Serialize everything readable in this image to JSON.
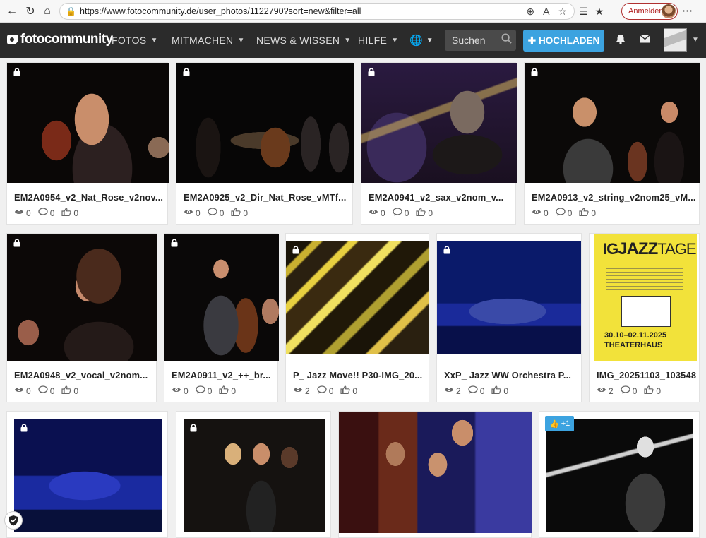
{
  "browser": {
    "url": "https://www.fotocommunity.de/user_photos/1122790?sort=new&filter=all",
    "login_label": "Anmelden"
  },
  "header": {
    "logo": "fotocommunity",
    "nav": [
      {
        "label": "FOTOS"
      },
      {
        "label": "MITMACHEN"
      },
      {
        "label": "NEWS & WISSEN"
      },
      {
        "label": "HILFE"
      }
    ],
    "search_placeholder": "Suchen",
    "upload_label": "HOCHLADEN"
  },
  "colors": {
    "header_bg": "#2b2b2b",
    "accent": "#3ca3e0"
  },
  "photos": [
    {
      "title": "EM2A0954_v2_Nat_Rose_v2nov...",
      "views": "0",
      "comments": "0",
      "likes": "0",
      "locked": true
    },
    {
      "title": "EM2A0925_v2_Dir_Nat_Rose_vMTf...",
      "views": "0",
      "comments": "0",
      "likes": "0",
      "locked": true
    },
    {
      "title": "EM2A0941_v2_sax_v2nom_v...",
      "views": "0",
      "comments": "0",
      "likes": "0",
      "locked": true
    },
    {
      "title": "EM2A0913_v2_string_v2nom25_vM...",
      "views": "0",
      "comments": "0",
      "likes": "0",
      "locked": true
    },
    {
      "title": "EM2A0948_v2_vocal_v2nom...",
      "views": "0",
      "comments": "0",
      "likes": "0",
      "locked": true
    },
    {
      "title": "EM2A0911_v2_++_br...",
      "views": "0",
      "comments": "0",
      "likes": "0",
      "locked": true
    },
    {
      "title": "P_ Jazz Move!! P30-IMG_20...",
      "views": "2",
      "comments": "0",
      "likes": "0",
      "locked": true
    },
    {
      "title": "XxP_ Jazz WW Orchestra P...",
      "views": "2",
      "comments": "0",
      "likes": "0",
      "locked": true
    },
    {
      "title": "IMG_20251103_103548",
      "views": "2",
      "comments": "0",
      "likes": "0",
      "locked": false
    },
    {
      "title": "",
      "locked": true
    },
    {
      "title": "",
      "locked": true
    },
    {
      "title": "",
      "locked": false
    },
    {
      "title": "",
      "locked": false,
      "like_badge": "+1"
    }
  ],
  "poster": {
    "line1": "IG",
    "line2": "JAZZ",
    "line3": "TAGE",
    "dates": "30.10–02.11.2025",
    "venue": "THEATERHAUS"
  }
}
